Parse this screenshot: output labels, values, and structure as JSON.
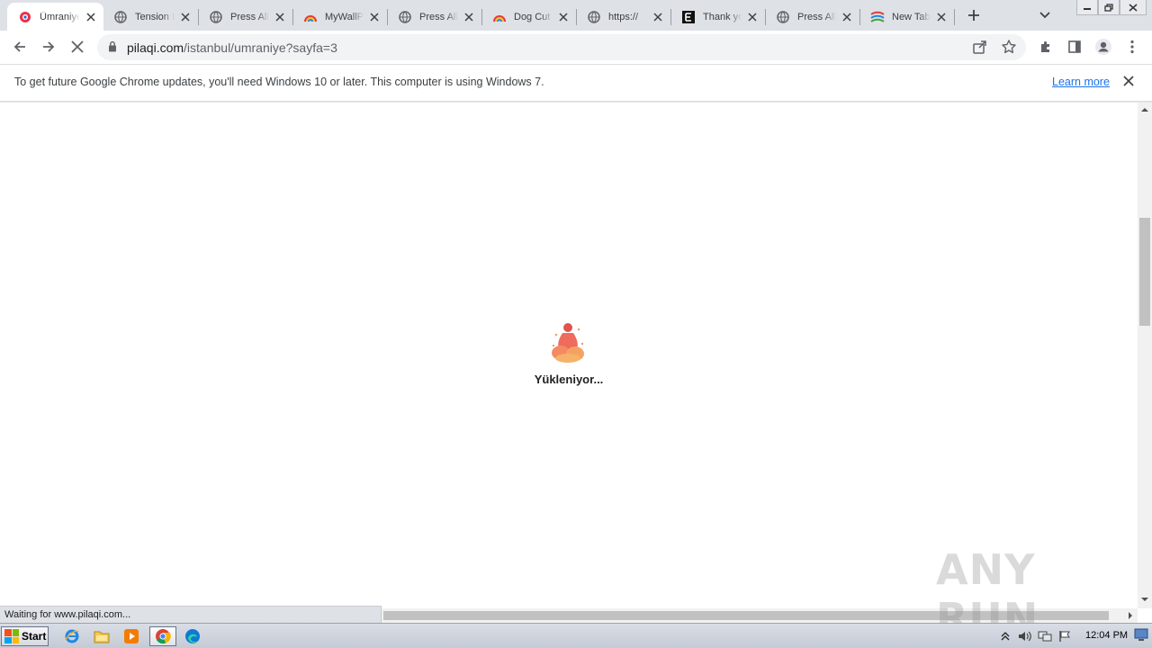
{
  "tabs": [
    {
      "title": "Ümraniye",
      "icon": "pilaqi-favicon",
      "active": true
    },
    {
      "title": "Tension I",
      "icon": "globe-icon"
    },
    {
      "title": "Press All",
      "icon": "globe-icon"
    },
    {
      "title": "MyWallP",
      "icon": "rainbow-favicon"
    },
    {
      "title": "Press All",
      "icon": "globe-icon"
    },
    {
      "title": "Dog Cut",
      "icon": "rainbow-favicon"
    },
    {
      "title": "https://",
      "icon": "globe-icon"
    },
    {
      "title": "Thank yo",
      "icon": "e-favicon"
    },
    {
      "title": "Press All",
      "icon": "globe-icon"
    },
    {
      "title": "New Tab",
      "icon": "newtab-favicon"
    }
  ],
  "omnibox": {
    "host": "pilaqi.com",
    "path": "/istanbul/umraniye?sayfa=3"
  },
  "infobar": {
    "message": "To get future Google Chrome updates, you'll need Windows 10 or later. This computer is using Windows 7.",
    "link": "Learn more"
  },
  "page": {
    "loading_text": "Yükleniyor..."
  },
  "status": {
    "text": "Waiting for www.pilaqi.com..."
  },
  "watermark": "ANY RUN",
  "taskbar": {
    "start_label": "Start",
    "clock": "12:04 PM"
  },
  "colors": {
    "tabstrip": "#dee1e6",
    "accent_link": "#1a73e8",
    "loader": "#ef6b5b"
  }
}
